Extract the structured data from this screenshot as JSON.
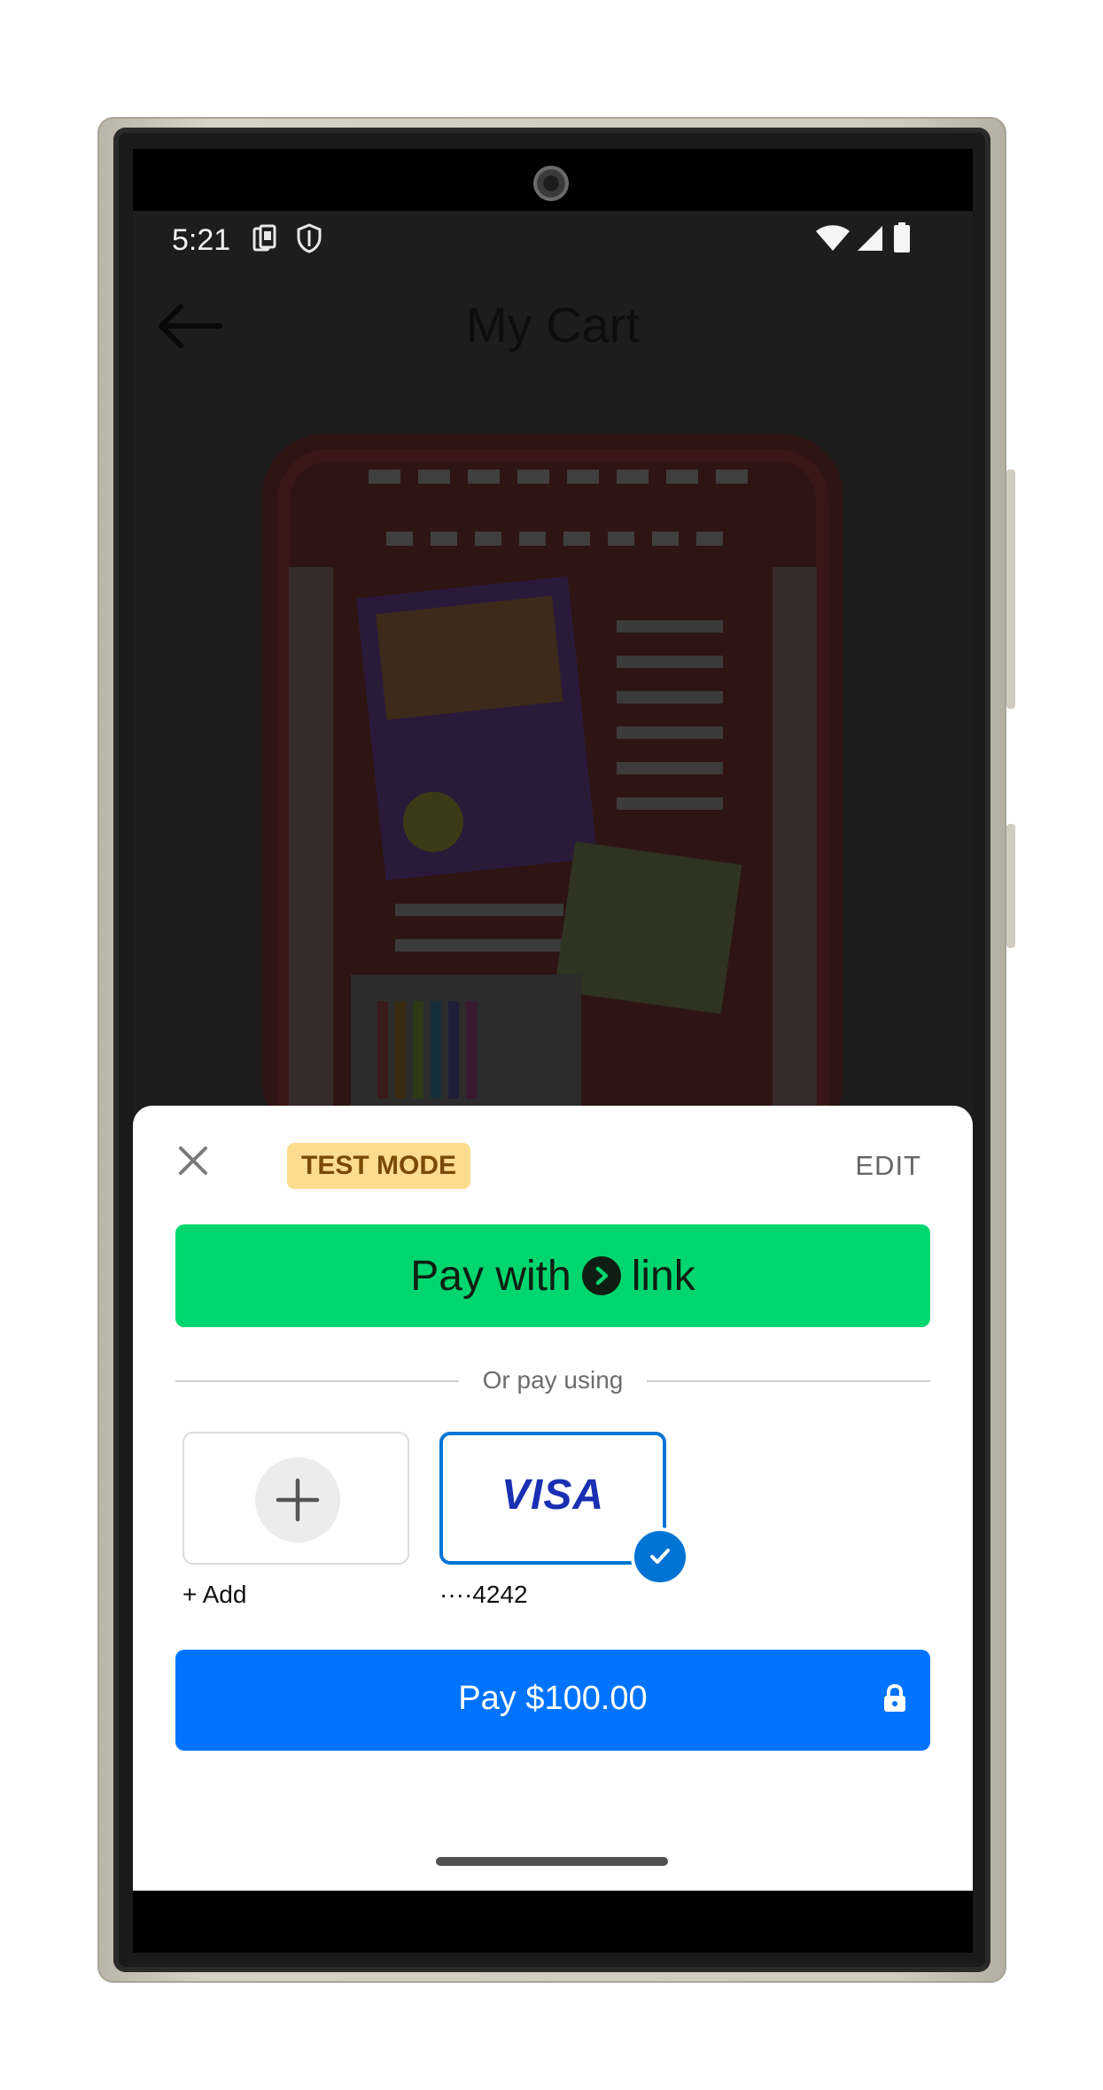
{
  "status_bar": {
    "time": "5:21",
    "left_icons": [
      "sim-card-icon",
      "shield-icon"
    ],
    "right_icons": [
      "wifi-icon",
      "signal-icon",
      "battery-icon"
    ]
  },
  "header": {
    "back_icon": "arrow-left-icon",
    "title": "My Cart"
  },
  "payment_sheet": {
    "close_icon": "close-icon",
    "badge": "TEST MODE",
    "edit_label": "EDIT",
    "link_button": {
      "prefix": "Pay with",
      "brand": "link",
      "brand_icon": "link-chevron-icon"
    },
    "divider_text": "Or pay using",
    "methods": [
      {
        "type": "add",
        "icon": "plus-icon",
        "label": "+ Add"
      },
      {
        "type": "card",
        "brand": "VISA",
        "label": "····4242",
        "selected": true
      }
    ],
    "pay_button": {
      "label": "Pay $100.00",
      "icon": "lock-icon"
    }
  },
  "colors": {
    "link_green": "#00d66f",
    "pay_blue": "#0074ff",
    "selected_blue": "#0074d4",
    "badge_bg": "#fddc8f",
    "visa_blue": "#1a2fb2"
  }
}
